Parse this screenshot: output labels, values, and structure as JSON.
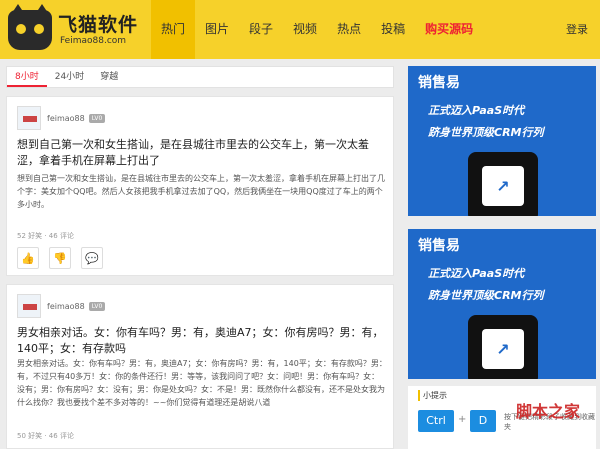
{
  "header": {
    "logo_name": "飞猫软件",
    "logo_domain": "Feimao88.com",
    "nav": [
      "热门",
      "图片",
      "段子",
      "视频",
      "热点",
      "投稿",
      "购买源码"
    ],
    "login": "登录"
  },
  "tabs": [
    "8小时",
    "24小时",
    "穿越"
  ],
  "posts": [
    {
      "author": "feimao88",
      "badge": "LV0",
      "title": "想到自己第一次和女生搭讪，是在县城往市里去的公交车上，第一次太羞涩，拿着手机在屏幕上打出了",
      "body": "想到自己第一次和女生搭讪，是在县城往市里去的公交车上，第一次太羞涩，拿着手机在屏幕上打出了几个字：美女加个QQ吧。然后人女孩把我手机拿过去加了QQ，然后我俩坐在一块用QQ度过了车上的两个多小时。",
      "meta": "52 好笑 · 46 评论"
    },
    {
      "author": "feimao88",
      "badge": "LV0",
      "title": "男女相亲对话。女：你有车吗？男：有，奥迪A7；女：你有房吗？男：有，140平；女：有存款吗",
      "body": "男女相亲对话。女：你有车吗？男：有，奥迪A7；女：你有房吗？男：有，140平；女：有存款吗？男：有，不过只有40多万！女：你的条件还行！男：等等，该我问问了吧？女：问吧！男：你有车吗？女：没有；男：你有房吗？女：没有；男：你是处女吗？女：不是！男：既然你什么都没有，还不是处女我为什么找你？我也要找个差不多对等的！~~你们觉得有道理还是胡说八道",
      "meta": "50 好笑 · 46 评论"
    }
  ],
  "ads": [
    {
      "brand": "销售易",
      "line1": "正式迈入PaaS时代",
      "line2": "跻身世界顶级CRM行列"
    },
    {
      "brand": "销售易",
      "line1": "正式迈入PaaS时代",
      "line2": "跻身世界顶级CRM行列"
    }
  ],
  "tips": {
    "title": "小提示",
    "key1": "Ctrl",
    "key2": "D",
    "text": "按下键把精彩段子收藏到收藏夹"
  },
  "watermark": "脚本之家",
  "colors": {
    "header": "#f6d12a",
    "accent": "#e23",
    "ad_blue": "#1f69c9",
    "key_blue": "#1c8de0"
  }
}
